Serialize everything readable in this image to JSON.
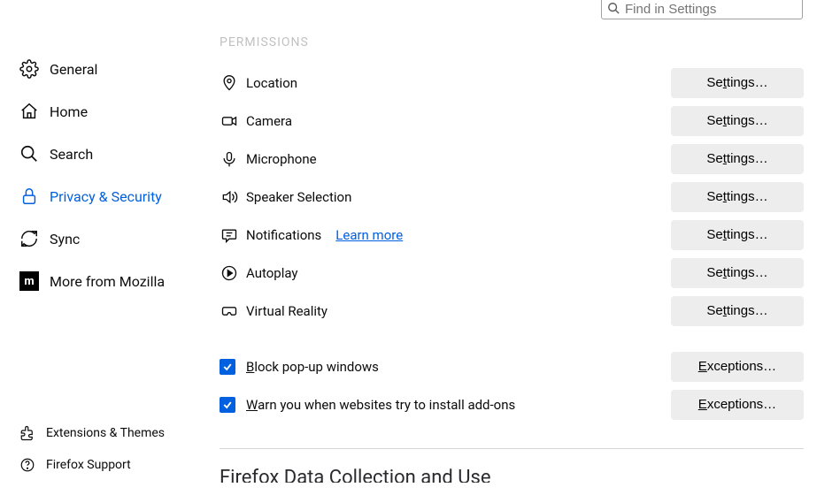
{
  "search": {
    "placeholder": "Find in Settings"
  },
  "sidebar": {
    "items": [
      {
        "label": "General"
      },
      {
        "label": "Home"
      },
      {
        "label": "Search"
      },
      {
        "label": "Privacy & Security"
      },
      {
        "label": "Sync"
      },
      {
        "label": "More from Mozilla"
      }
    ],
    "bottom": [
      {
        "label": "Extensions & Themes"
      },
      {
        "label": "Firefox Support"
      }
    ]
  },
  "main": {
    "heading_partial": "PERMISSIONS",
    "permissions": [
      {
        "label": "Location",
        "button_pre": "Se",
        "button_u": "t",
        "button_post": "tings…"
      },
      {
        "label": "Camera",
        "button_pre": "Se",
        "button_u": "t",
        "button_post": "tings…"
      },
      {
        "label": "Microphone",
        "button_pre": "Se",
        "button_u": "t",
        "button_post": "tings…"
      },
      {
        "label": "Speaker Selection",
        "button_pre": "Se",
        "button_u": "t",
        "button_post": "tings…"
      },
      {
        "label": "Notifications",
        "learn_more": "Learn more",
        "button_pre": "Se",
        "button_u": "t",
        "button_post": "tings…"
      },
      {
        "label": "Autoplay",
        "button_pre": "Se",
        "button_u": "t",
        "button_post": "tings…"
      },
      {
        "label": "Virtual Reality",
        "button_pre": "Se",
        "button_u": "t",
        "button_post": "tings…"
      }
    ],
    "checkbox_popups": {
      "checked": true,
      "label_u": "B",
      "label_rest": "lock pop-up windows",
      "button_u": "E",
      "button_rest": "xceptions…"
    },
    "checkbox_addons": {
      "checked": true,
      "label_u": "W",
      "label_rest": "arn you when websites try to install add-ons",
      "button_u": "E",
      "button_rest": "xceptions…"
    },
    "next_section_partial": "Firefox Data Collection and Use"
  },
  "colors": {
    "accent": "#0060df"
  }
}
